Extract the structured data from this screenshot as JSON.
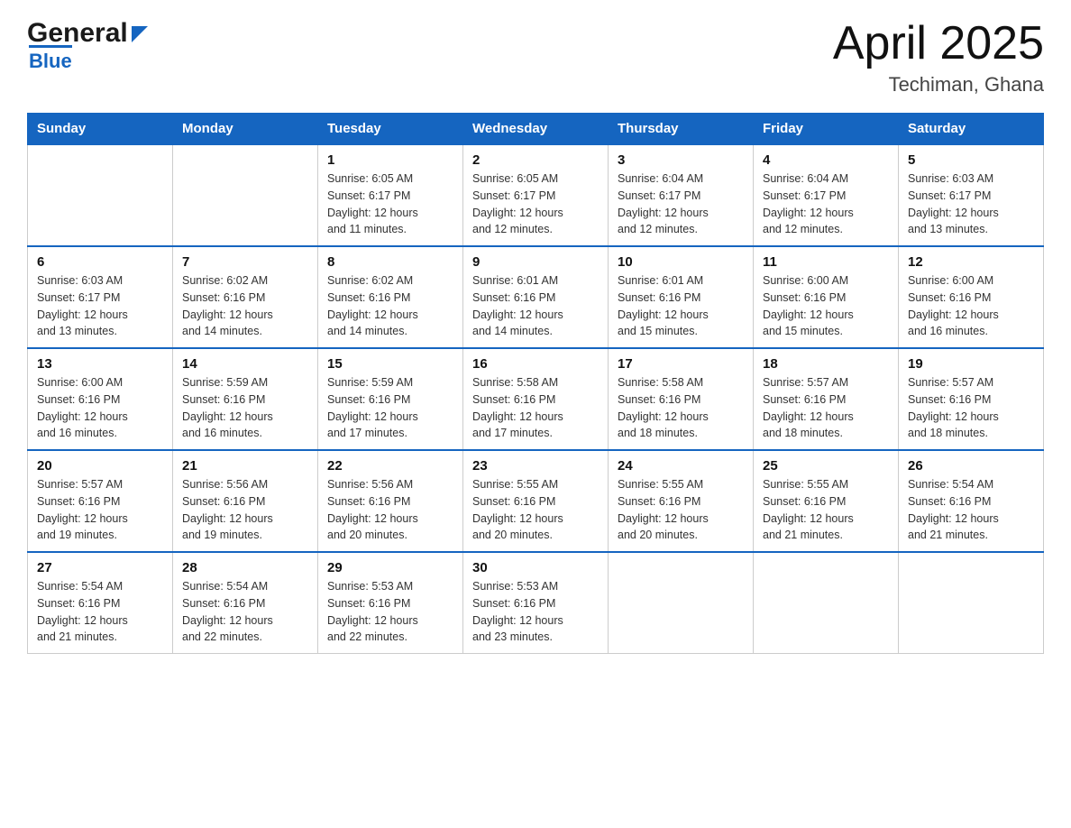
{
  "header": {
    "logo": {
      "general": "General",
      "blue": "Blue",
      "alt": "GeneralBlue logo"
    },
    "month_title": "April 2025",
    "location": "Techiman, Ghana"
  },
  "weekdays": [
    "Sunday",
    "Monday",
    "Tuesday",
    "Wednesday",
    "Thursday",
    "Friday",
    "Saturday"
  ],
  "weeks": [
    [
      {
        "day": "",
        "info": ""
      },
      {
        "day": "",
        "info": ""
      },
      {
        "day": "1",
        "info": "Sunrise: 6:05 AM\nSunset: 6:17 PM\nDaylight: 12 hours\nand 11 minutes."
      },
      {
        "day": "2",
        "info": "Sunrise: 6:05 AM\nSunset: 6:17 PM\nDaylight: 12 hours\nand 12 minutes."
      },
      {
        "day": "3",
        "info": "Sunrise: 6:04 AM\nSunset: 6:17 PM\nDaylight: 12 hours\nand 12 minutes."
      },
      {
        "day": "4",
        "info": "Sunrise: 6:04 AM\nSunset: 6:17 PM\nDaylight: 12 hours\nand 12 minutes."
      },
      {
        "day": "5",
        "info": "Sunrise: 6:03 AM\nSunset: 6:17 PM\nDaylight: 12 hours\nand 13 minutes."
      }
    ],
    [
      {
        "day": "6",
        "info": "Sunrise: 6:03 AM\nSunset: 6:17 PM\nDaylight: 12 hours\nand 13 minutes."
      },
      {
        "day": "7",
        "info": "Sunrise: 6:02 AM\nSunset: 6:16 PM\nDaylight: 12 hours\nand 14 minutes."
      },
      {
        "day": "8",
        "info": "Sunrise: 6:02 AM\nSunset: 6:16 PM\nDaylight: 12 hours\nand 14 minutes."
      },
      {
        "day": "9",
        "info": "Sunrise: 6:01 AM\nSunset: 6:16 PM\nDaylight: 12 hours\nand 14 minutes."
      },
      {
        "day": "10",
        "info": "Sunrise: 6:01 AM\nSunset: 6:16 PM\nDaylight: 12 hours\nand 15 minutes."
      },
      {
        "day": "11",
        "info": "Sunrise: 6:00 AM\nSunset: 6:16 PM\nDaylight: 12 hours\nand 15 minutes."
      },
      {
        "day": "12",
        "info": "Sunrise: 6:00 AM\nSunset: 6:16 PM\nDaylight: 12 hours\nand 16 minutes."
      }
    ],
    [
      {
        "day": "13",
        "info": "Sunrise: 6:00 AM\nSunset: 6:16 PM\nDaylight: 12 hours\nand 16 minutes."
      },
      {
        "day": "14",
        "info": "Sunrise: 5:59 AM\nSunset: 6:16 PM\nDaylight: 12 hours\nand 16 minutes."
      },
      {
        "day": "15",
        "info": "Sunrise: 5:59 AM\nSunset: 6:16 PM\nDaylight: 12 hours\nand 17 minutes."
      },
      {
        "day": "16",
        "info": "Sunrise: 5:58 AM\nSunset: 6:16 PM\nDaylight: 12 hours\nand 17 minutes."
      },
      {
        "day": "17",
        "info": "Sunrise: 5:58 AM\nSunset: 6:16 PM\nDaylight: 12 hours\nand 18 minutes."
      },
      {
        "day": "18",
        "info": "Sunrise: 5:57 AM\nSunset: 6:16 PM\nDaylight: 12 hours\nand 18 minutes."
      },
      {
        "day": "19",
        "info": "Sunrise: 5:57 AM\nSunset: 6:16 PM\nDaylight: 12 hours\nand 18 minutes."
      }
    ],
    [
      {
        "day": "20",
        "info": "Sunrise: 5:57 AM\nSunset: 6:16 PM\nDaylight: 12 hours\nand 19 minutes."
      },
      {
        "day": "21",
        "info": "Sunrise: 5:56 AM\nSunset: 6:16 PM\nDaylight: 12 hours\nand 19 minutes."
      },
      {
        "day": "22",
        "info": "Sunrise: 5:56 AM\nSunset: 6:16 PM\nDaylight: 12 hours\nand 20 minutes."
      },
      {
        "day": "23",
        "info": "Sunrise: 5:55 AM\nSunset: 6:16 PM\nDaylight: 12 hours\nand 20 minutes."
      },
      {
        "day": "24",
        "info": "Sunrise: 5:55 AM\nSunset: 6:16 PM\nDaylight: 12 hours\nand 20 minutes."
      },
      {
        "day": "25",
        "info": "Sunrise: 5:55 AM\nSunset: 6:16 PM\nDaylight: 12 hours\nand 21 minutes."
      },
      {
        "day": "26",
        "info": "Sunrise: 5:54 AM\nSunset: 6:16 PM\nDaylight: 12 hours\nand 21 minutes."
      }
    ],
    [
      {
        "day": "27",
        "info": "Sunrise: 5:54 AM\nSunset: 6:16 PM\nDaylight: 12 hours\nand 21 minutes."
      },
      {
        "day": "28",
        "info": "Sunrise: 5:54 AM\nSunset: 6:16 PM\nDaylight: 12 hours\nand 22 minutes."
      },
      {
        "day": "29",
        "info": "Sunrise: 5:53 AM\nSunset: 6:16 PM\nDaylight: 12 hours\nand 22 minutes."
      },
      {
        "day": "30",
        "info": "Sunrise: 5:53 AM\nSunset: 6:16 PM\nDaylight: 12 hours\nand 23 minutes."
      },
      {
        "day": "",
        "info": ""
      },
      {
        "day": "",
        "info": ""
      },
      {
        "day": "",
        "info": ""
      }
    ]
  ]
}
